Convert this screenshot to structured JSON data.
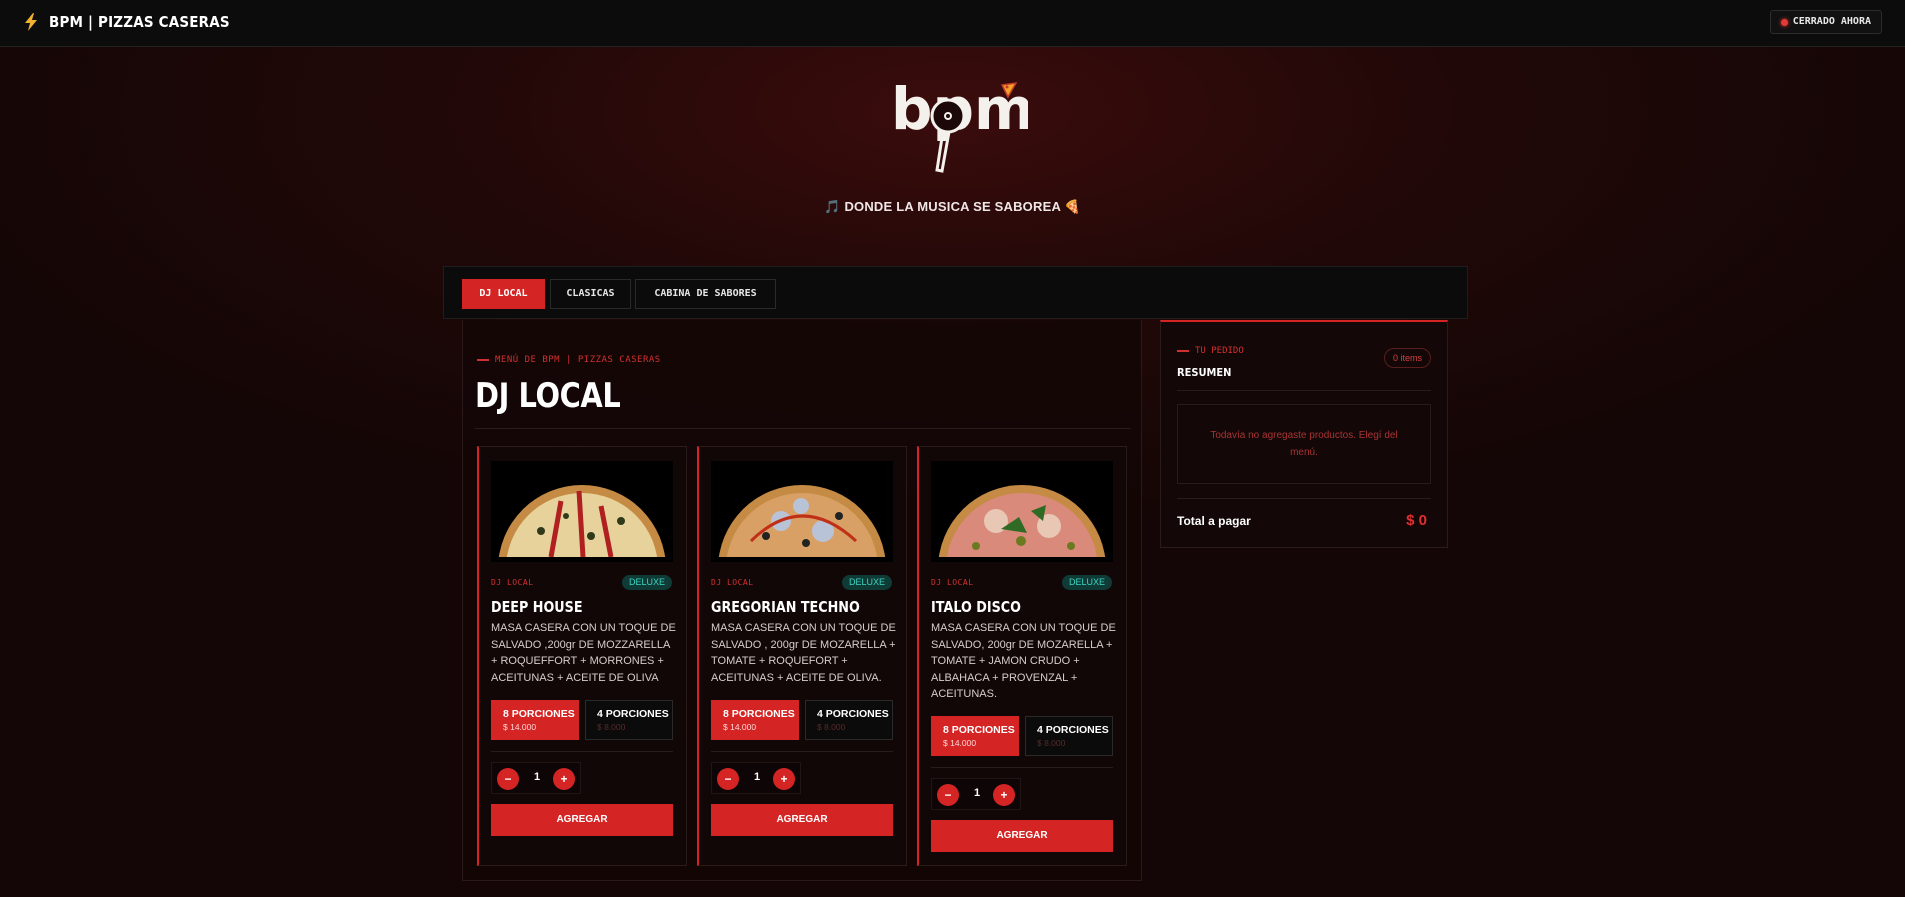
{
  "topbar": {
    "title": "BPM | PIZZAS CASERAS",
    "icon": "bolt-icon",
    "status": "CERRADO AHORA"
  },
  "hero": {
    "logo_text": "bpm",
    "tagline": "🎵 DONDE LA MUSICA SE SABOREA 🍕"
  },
  "tabs": [
    {
      "label": "DJ LOCAL"
    },
    {
      "label": "CLASICAS"
    },
    {
      "label": "CABINA DE SABORES"
    }
  ],
  "menu": {
    "eyebrow": "MENÚ DE BPM | PIZZAS CASERAS",
    "title": "DJ LOCAL",
    "products": [
      {
        "category": "DJ LOCAL",
        "badge": "DELUXE",
        "name": "DEEP HOUSE",
        "description": "MASA CASERA CON UN TOQUE DE SALVADO ,200gr DE MOZZARELLA + ROQUEFFORT + MORRONES + ACEITUNAS + ACEITE DE OLIVA",
        "options": [
          {
            "label": "8 PORCIONES",
            "price": "$ 14.000"
          },
          {
            "label": "4 PORCIONES",
            "price": "$ 8.000"
          }
        ],
        "qty": "1",
        "qty_minus": "−",
        "qty_plus": "+",
        "add": "AGREGAR"
      },
      {
        "category": "DJ LOCAL",
        "badge": "DELUXE",
        "name": "GREGORIAN TECHNO",
        "description": "MASA CASERA CON UN TOQUE DE SALVADO , 200gr DE MOZARELLA + TOMATE + ROQUEFORT + ACEITUNAS + ACEITE DE OLIVA.",
        "options": [
          {
            "label": "8 PORCIONES",
            "price": "$ 14.000"
          },
          {
            "label": "4 PORCIONES",
            "price": "$ 8.000"
          }
        ],
        "qty": "1",
        "qty_minus": "−",
        "qty_plus": "+",
        "add": "AGREGAR"
      },
      {
        "category": "DJ LOCAL",
        "badge": "DELUXE",
        "name": "ITALO DISCO",
        "description": "MASA CASERA CON UN TOQUE DE SALVADO, 200gr DE MOZARELLA + TOMATE + JAMON CRUDO + ALBAHACA + PROVENZAL + ACEITUNAS.",
        "options": [
          {
            "label": "8 PORCIONES",
            "price": "$ 14.000"
          },
          {
            "label": "4 PORCIONES",
            "price": "$ 8.000"
          }
        ],
        "qty": "1",
        "qty_minus": "−",
        "qty_plus": "+",
        "add": "AGREGAR"
      }
    ]
  },
  "cart": {
    "eyebrow": "TU PEDIDO",
    "title": "RESUMEN",
    "items": "0 items",
    "empty": "Todavía no agregaste productos. Elegí del menú.",
    "total_label": "Total a pagar",
    "total_value": "$ 0"
  },
  "colors": {
    "accent": "#d42424",
    "badge": "#3dd6c3"
  }
}
